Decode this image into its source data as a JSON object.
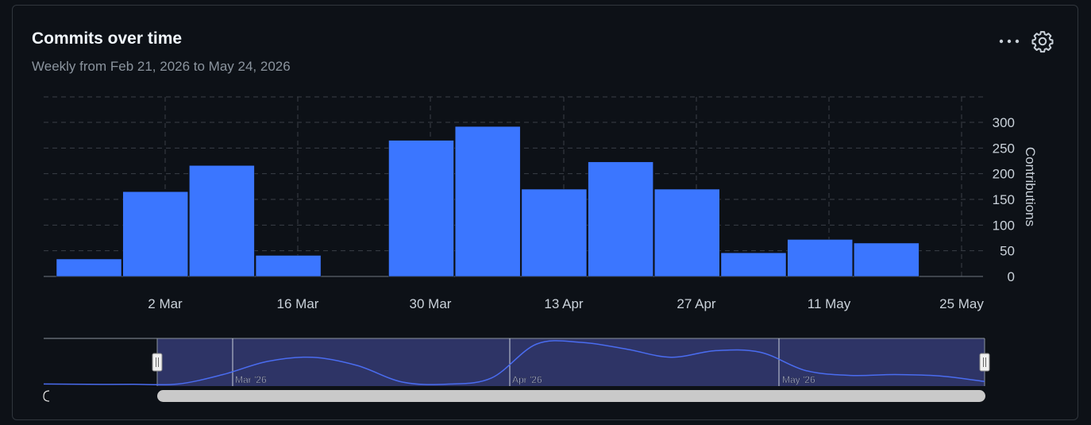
{
  "header": {
    "title": "Commits over time",
    "subtitle": "Weekly from Feb 21, 2026 to May 24, 2026"
  },
  "icons": {
    "more": "kebab-horizontal-icon",
    "settings": "gear-icon"
  },
  "colors": {
    "bar": "#3b76ff",
    "background": "#0d1117",
    "grid": "#3a3f47",
    "navigator_fill": "#2e3466",
    "navigator_line": "#4a6cf0",
    "scrollbar": "#c9c9c9"
  },
  "chart_data": {
    "type": "bar",
    "ylabel": "Contributions",
    "y_axis_position": "right",
    "ylim": [
      0,
      300
    ],
    "yticks": [
      0,
      50,
      100,
      150,
      200,
      250,
      300
    ],
    "grid": true,
    "x_tick_labels": [
      "2 Mar",
      "16 Mar",
      "30 Mar",
      "13 Apr",
      "27 Apr",
      "11 May",
      "25 May"
    ],
    "weeks": [
      "Feb 22",
      "Mar 1",
      "Mar 8",
      "Mar 15",
      "Mar 22",
      "Mar 29",
      "Apr 5",
      "Apr 12",
      "Apr 19",
      "Apr 26",
      "May 3",
      "May 10",
      "May 17"
    ],
    "values": [
      34,
      165,
      216,
      41,
      0,
      265,
      292,
      170,
      223,
      170,
      46,
      72,
      65
    ]
  },
  "navigator": {
    "labels": [
      "Mar '26",
      "Apr '26",
      "May '26"
    ],
    "values": [
      3,
      1,
      1,
      3,
      60,
      140,
      165,
      115,
      15,
      2,
      40,
      245,
      255,
      215,
      165,
      205,
      195,
      85,
      55,
      60,
      52,
      18
    ]
  }
}
